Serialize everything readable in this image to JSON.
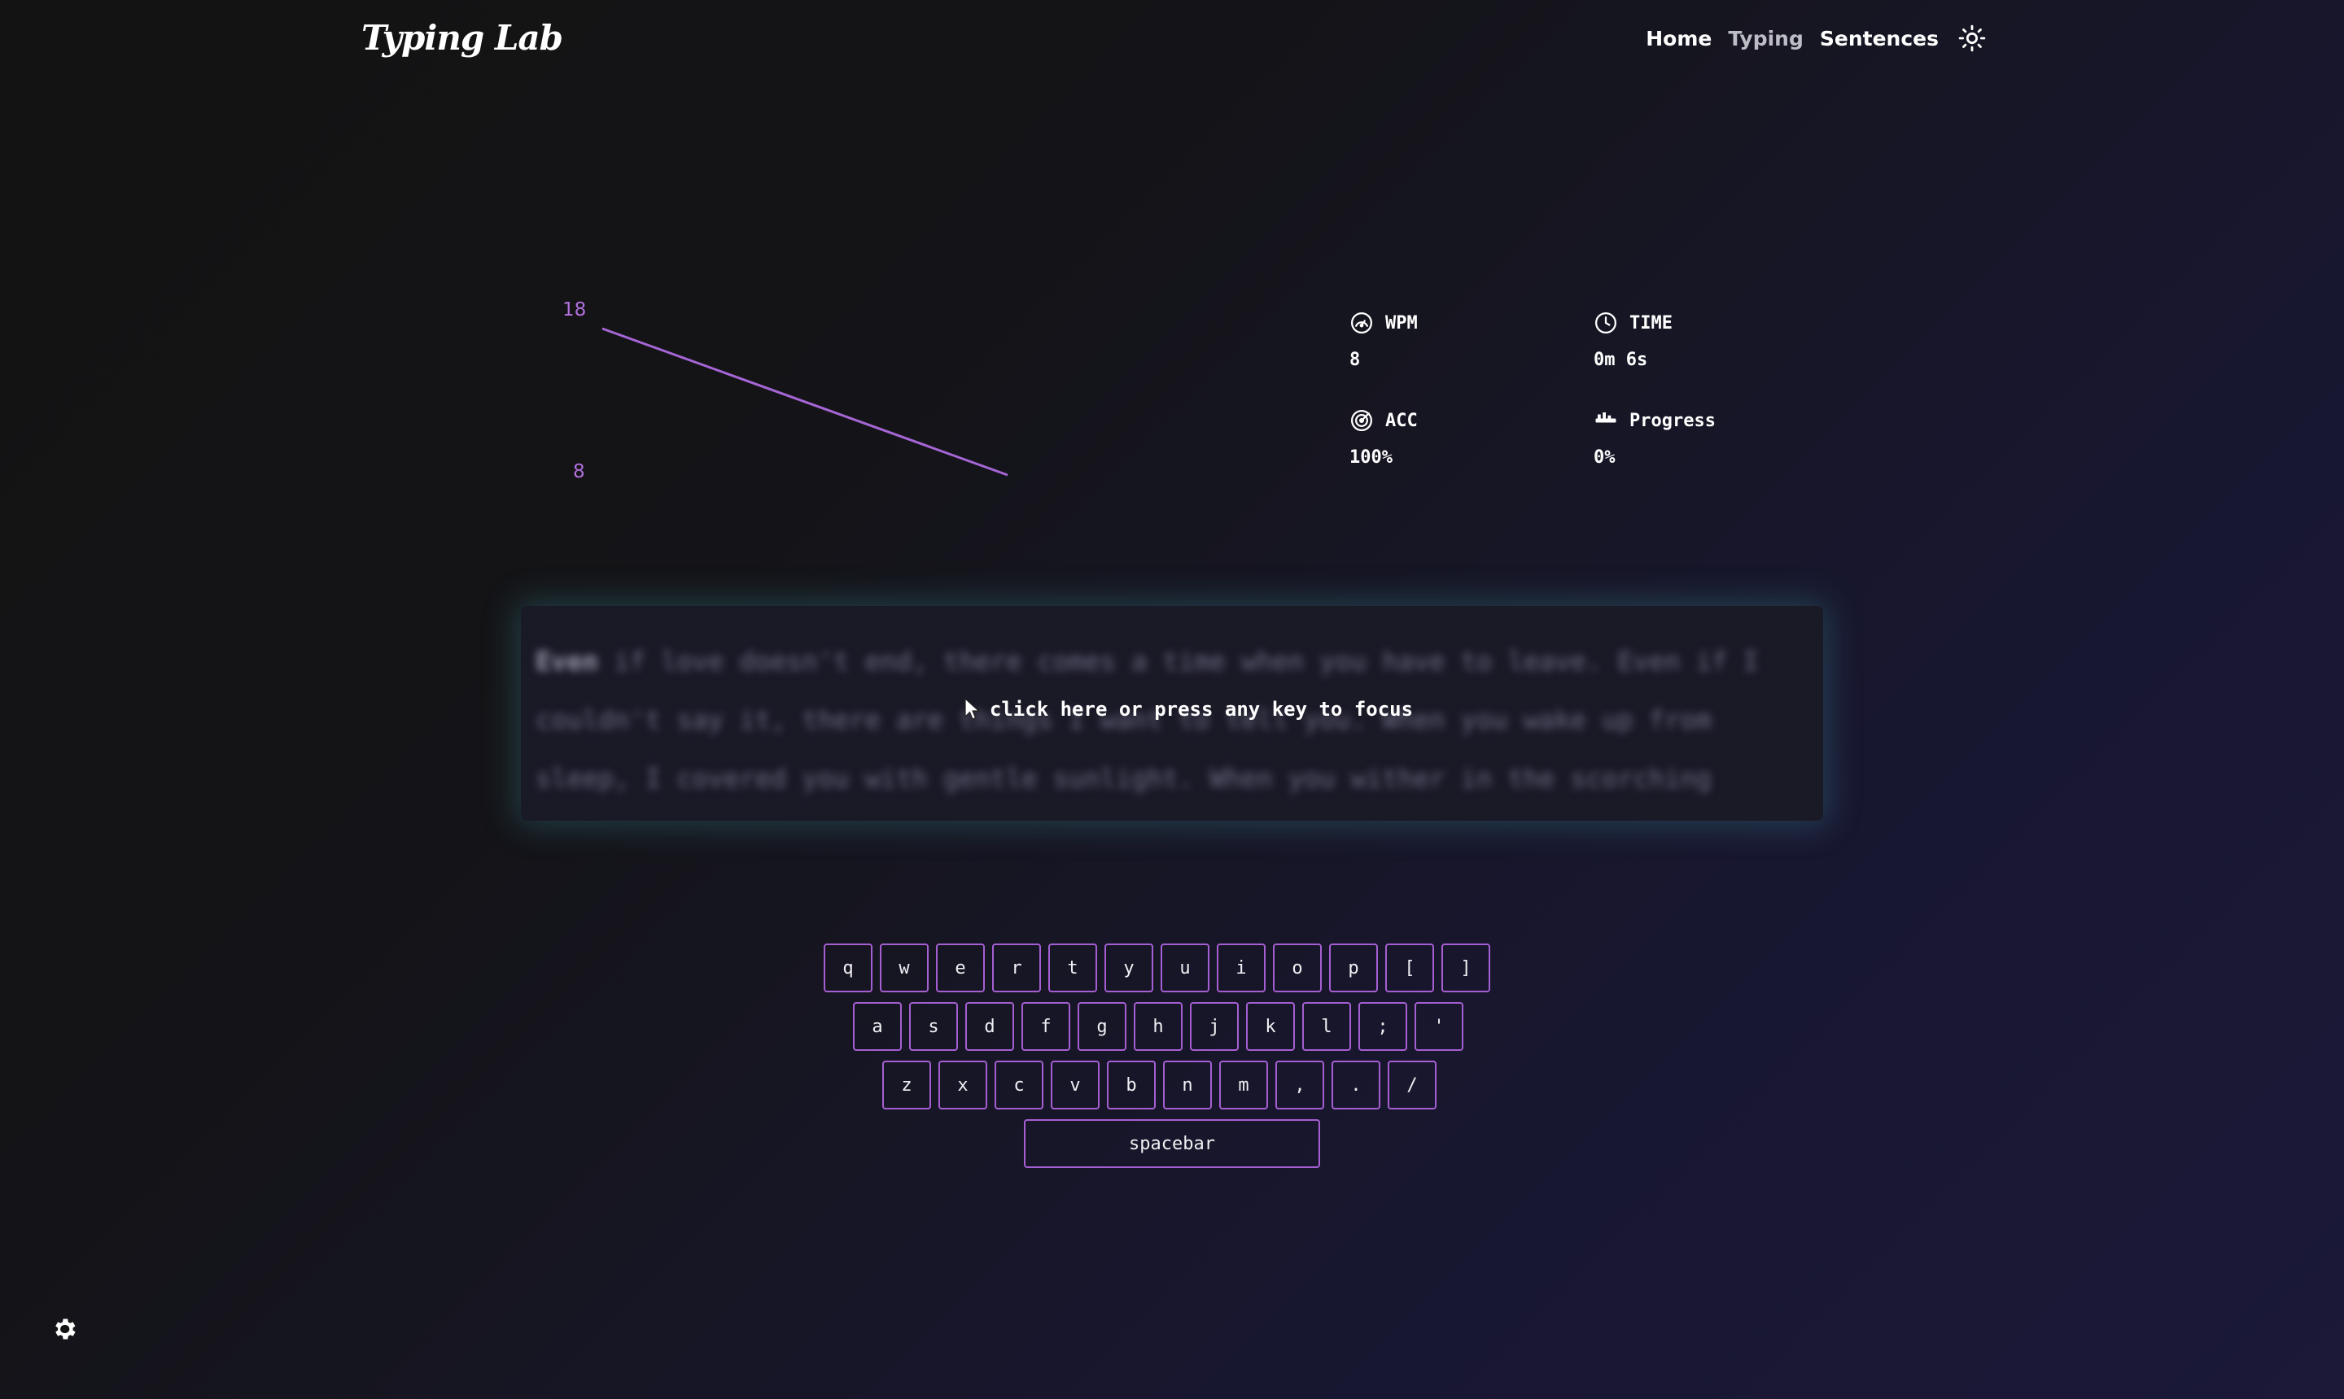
{
  "header": {
    "logo": "Typing Lab",
    "nav": {
      "home": "Home",
      "typing": "Typing",
      "sentences": "Sentences"
    }
  },
  "chart_data": {
    "type": "line",
    "title": "",
    "xlabel": "",
    "ylabel": "",
    "y_tick_labels": [
      "18",
      "8"
    ],
    "ylim": [
      8,
      18
    ],
    "series": [
      {
        "values": [
          18,
          8
        ]
      }
    ],
    "line_color": "#a666d6",
    "grid": false
  },
  "stats": {
    "wpm": {
      "label": "WPM",
      "value": "8"
    },
    "time": {
      "label": "TIME",
      "value": "0m 6s"
    },
    "acc": {
      "label": "ACC",
      "value": "100%"
    },
    "progress": {
      "label": "Progress",
      "value": "0%"
    }
  },
  "typing": {
    "typed": "Even",
    "remaining": " if love doesn't end, there comes a time when you have to leave. Even if I couldn't say it, there are things I want to tell you. When you wake up from sleep, I covered you with gentle sunlight. When you wither in the scorching heat,",
    "focus_hint": "click here or press any key to focus"
  },
  "keyboard": {
    "rows": [
      [
        "q",
        "w",
        "e",
        "r",
        "t",
        "y",
        "u",
        "i",
        "o",
        "p",
        "[",
        "]"
      ],
      [
        "a",
        "s",
        "d",
        "f",
        "g",
        "h",
        "j",
        "k",
        "l",
        ";",
        "'"
      ],
      [
        "z",
        "x",
        "c",
        "v",
        "b",
        "n",
        "m",
        ",",
        ".",
        "/"
      ]
    ],
    "spacebar": "spacebar"
  },
  "colors": {
    "accent": "#a65fd2",
    "chart_line": "#a666d6",
    "glow": "#3c8c96"
  }
}
